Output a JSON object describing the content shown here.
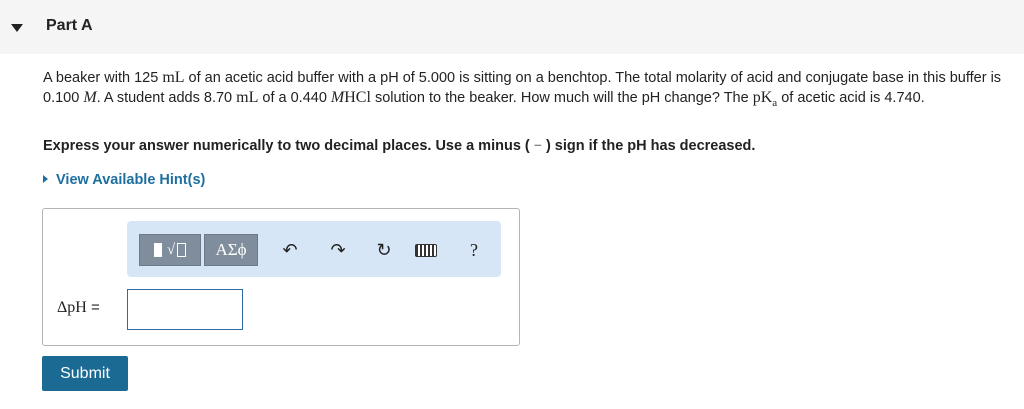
{
  "part": {
    "title": "Part A"
  },
  "question": {
    "s1": "A beaker with 125 ",
    "unit_ml": "mL",
    "s2": " of an acetic acid buffer with a pH of 5.000 is sitting on a benchtop. The total molarity of acid and conjugate base in this buffer is 0.100 ",
    "unit_M": "M",
    "s3": ". A student adds 8.70 ",
    "unit_ml2": "mL",
    "s4": " of a 0.440 ",
    "unit_M2": "M",
    "chem_HCl": "HCl",
    "s5": " solution to the beaker. How much will the pH change? The ",
    "pKa_p": "pK",
    "pKa_sub": "a",
    "s6": " of acetic acid is 4.740."
  },
  "instruction": {
    "before": "Express your answer numerically to two decimal places. Use a minus (",
    "minus": "−",
    "after": ") sign if the pH has decreased."
  },
  "hints": {
    "label": "View Available Hint(s)"
  },
  "toolbar": {
    "greek_label": "ΑΣϕ",
    "root_symbol": "√",
    "undo_glyph": "↶",
    "redo_glyph": "↷",
    "reset_glyph": "↻",
    "help_label": "?"
  },
  "answer": {
    "label_math": "ΔpH",
    "label_eq": " =",
    "value": "",
    "placeholder": ""
  },
  "submit": {
    "label": "Submit"
  },
  "colors": {
    "accent": "#1a6a93",
    "link": "#1e6f9f",
    "toolbar_bg": "#d7e6f6",
    "button_gray": "#7f8d9c"
  }
}
